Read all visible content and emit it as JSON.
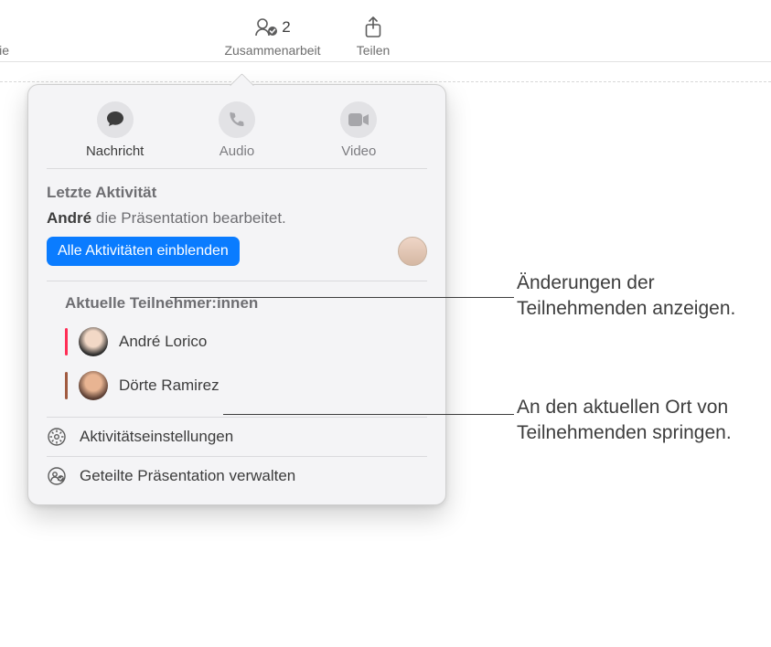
{
  "toolbar": {
    "slide_label": "e Folie",
    "collab_count": "2",
    "collab_label": "Zusammenarbeit",
    "share_label": "Teilen"
  },
  "popover": {
    "contact": {
      "message_label": "Nachricht",
      "audio_label": "Audio",
      "video_label": "Video"
    },
    "activity": {
      "heading": "Letzte Aktivität",
      "actor": "André",
      "verb_phrase": "die Präsentation bearbeitet.",
      "show_all_label": "Alle Aktivitäten einblenden"
    },
    "participants": {
      "heading": "Aktuelle Teilnehmer:innen",
      "list": [
        {
          "name": "André Lorico",
          "presence_color": "#ff2d55"
        },
        {
          "name": "Dörte Ramirez",
          "presence_color": "#a05a3f"
        }
      ]
    },
    "footer": {
      "activity_settings_label": "Aktivitätseinstellungen",
      "manage_label": "Geteilte Präsentation verwalten"
    }
  },
  "callouts": {
    "c1": "Änderungen der Teilnehmenden anzeigen.",
    "c2": "An den aktuellen Ort von Teilnehmenden springen."
  }
}
